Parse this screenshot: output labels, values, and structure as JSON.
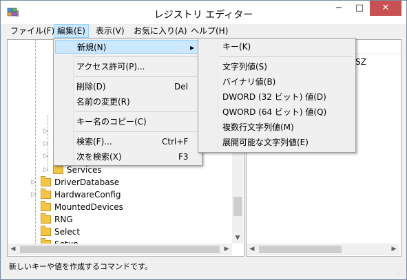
{
  "window": {
    "title": "レジストリ エディター"
  },
  "title_buttons": {
    "minimize": "−",
    "maximize": "□",
    "close": "✕"
  },
  "menubar": [
    {
      "label": "ファイル(F)"
    },
    {
      "label": "編集(E)"
    },
    {
      "label": "表示(V)"
    },
    {
      "label": "お気に入り(A)"
    },
    {
      "label": "ヘルプ(H)"
    }
  ],
  "edit_menu": {
    "items": [
      {
        "label": "新規(N)",
        "shortcut": ""
      },
      {
        "label": "アクセス許可(P)...",
        "shortcut": ""
      },
      {
        "label": "削除(D)",
        "shortcut": "Del"
      },
      {
        "label": "名前の変更(R)",
        "shortcut": ""
      },
      {
        "label": "キー名のコピー(C)",
        "shortcut": ""
      },
      {
        "label": "検索(F)...",
        "shortcut": "Ctrl+F"
      },
      {
        "label": "次を検索(X)",
        "shortcut": "F3"
      }
    ],
    "submenu_arrow": "▸"
  },
  "new_submenu": {
    "items": [
      {
        "label": "キー(K)"
      },
      {
        "label": "文字列値(S)"
      },
      {
        "label": "バイナリ値(B)"
      },
      {
        "label": "DWORD (32 ビット) 値(D)"
      },
      {
        "label": "QWORD (64 ビット) 値(Q)"
      },
      {
        "label": "複数行文字列値(M)"
      },
      {
        "label": "展開可能な文字列値(E)"
      }
    ]
  },
  "tree": {
    "items": [
      {
        "label": "Services",
        "expander": "▷"
      },
      {
        "label": "DriverDatabase",
        "expander": "▷"
      },
      {
        "label": "HardwareConfig",
        "expander": "▷"
      },
      {
        "label": "MountedDevices",
        "expander": ""
      },
      {
        "label": "RNG",
        "expander": ""
      },
      {
        "label": "Select",
        "expander": ""
      },
      {
        "label": "Setup",
        "expander": ""
      }
    ],
    "partial_expanders": [
      "▷",
      "▷",
      "▷"
    ]
  },
  "right_pane": {
    "visible_text": "SZ"
  },
  "scroll_arrows": {
    "up": "▲",
    "down": "▼",
    "left": "◀",
    "right": "▶"
  },
  "statusbar": {
    "text": "新しいキーや値を作成するコマンドです。"
  }
}
